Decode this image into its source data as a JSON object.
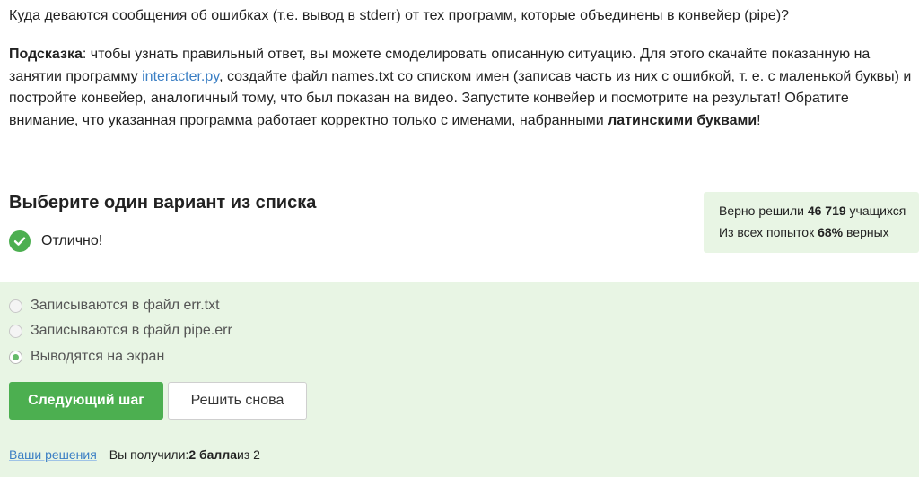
{
  "question": {
    "text": "Куда деваются сообщения об ошибках (т.е. вывод в stderr) от тех программ, которые объединены в конвейер (pipe)?"
  },
  "hint": {
    "label": "Подсказка",
    "line1_text": ": чтобы узнать правильный ответ, вы можете смоделировать описанную ситуацию. Для этого скачайте показанную на",
    "line2_prefix": "занятии программу ",
    "link_text": "interacter.py",
    "line2_suffix": ", создайте файл names.txt со списком имен (записав часть из них с ошибкой, т. е. с маленькой буквы) и",
    "line3_text": "постройте конвейер, аналогичный тому, что был показан на видео. Запустите конвейер и посмотрите на результат! Обратите",
    "line4_prefix": "внимание, что указанная программа работает корректно только с именами, набранными ",
    "line4_bold": "латинскими буквами",
    "line4_suffix": "!"
  },
  "choice": {
    "title": "Выберите один вариант из списка",
    "status_text": "Отлично!"
  },
  "stats": {
    "solved_prefix": "Верно решили ",
    "solved_count": "46 719",
    "solved_suffix": " учащихся",
    "attempts_prefix": "Из всех попыток ",
    "attempts_percent": "68%",
    "attempts_suffix": " верных"
  },
  "options": [
    {
      "label": "Записываются в файл err.txt",
      "selected": false
    },
    {
      "label": "Записываются в файл pipe.err",
      "selected": false
    },
    {
      "label": "Выводятся на экран",
      "selected": true
    }
  ],
  "buttons": {
    "next_label": "Следующий шаг",
    "retry_label": "Решить снова"
  },
  "footer": {
    "solutions_link": "Ваши решения",
    "score_prefix": "Вы получили: ",
    "score_bold": "2 балла",
    "score_suffix": " из 2"
  },
  "colors": {
    "accent_green": "#4caf50",
    "answer_bg": "#e8f5e4",
    "link_blue": "#3b7fc4"
  },
  "icons": {
    "status": "check-circle-icon",
    "radio_selected": "radio-selected-icon",
    "radio_unselected": "radio-unselected-icon"
  }
}
